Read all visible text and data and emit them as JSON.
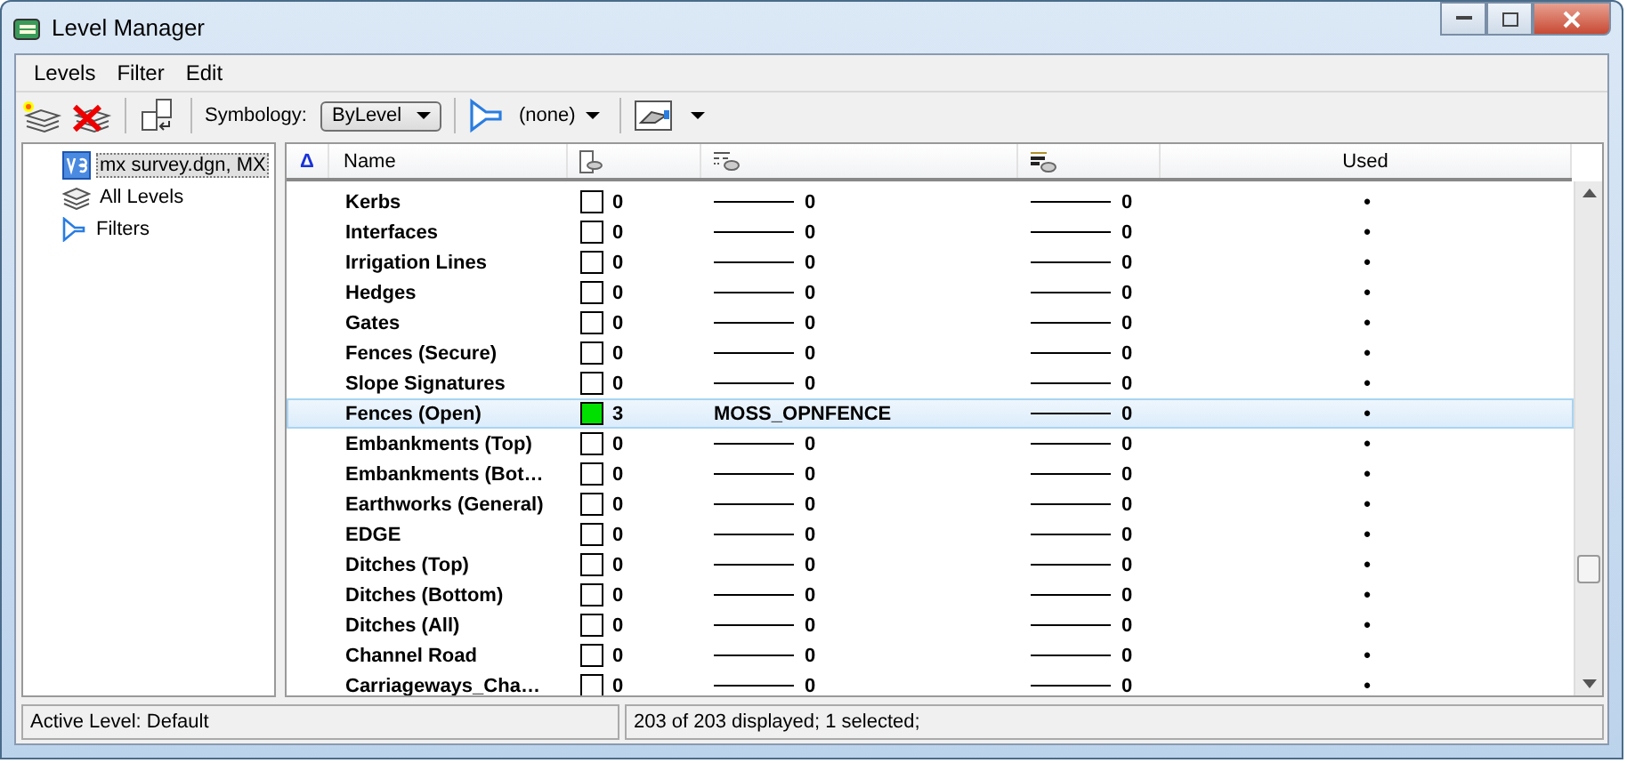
{
  "window": {
    "title": "Level Manager"
  },
  "menu": [
    "Levels",
    "Filter",
    "Edit"
  ],
  "toolbar": {
    "symbology_label": "Symbology:",
    "symbology_value": "ByLevel",
    "filter_value": "(none)"
  },
  "tree": [
    {
      "label": "mx survey.dgn, MX",
      "kind": "file",
      "selected": true
    },
    {
      "label": "All Levels",
      "kind": "levels",
      "selected": false
    },
    {
      "label": "Filters",
      "kind": "filter",
      "selected": false
    }
  ],
  "table": {
    "sort_mark": "Δ",
    "columns": [
      "Name",
      "Used"
    ],
    "rows": [
      {
        "name": "Kerbs",
        "color": "#ffffff",
        "color_num": "0",
        "style": {
          "kind": "line",
          "text": "0"
        },
        "weight": "0",
        "used": "•",
        "selected": false
      },
      {
        "name": "Interfaces",
        "color": "#ffffff",
        "color_num": "0",
        "style": {
          "kind": "line",
          "text": "0"
        },
        "weight": "0",
        "used": "•",
        "selected": false
      },
      {
        "name": "Irrigation Lines",
        "color": "#ffffff",
        "color_num": "0",
        "style": {
          "kind": "line",
          "text": "0"
        },
        "weight": "0",
        "used": "•",
        "selected": false
      },
      {
        "name": "Hedges",
        "color": "#ffffff",
        "color_num": "0",
        "style": {
          "kind": "line",
          "text": "0"
        },
        "weight": "0",
        "used": "•",
        "selected": false
      },
      {
        "name": "Gates",
        "color": "#ffffff",
        "color_num": "0",
        "style": {
          "kind": "line",
          "text": "0"
        },
        "weight": "0",
        "used": "•",
        "selected": false
      },
      {
        "name": "Fences (Secure)",
        "color": "#ffffff",
        "color_num": "0",
        "style": {
          "kind": "line",
          "text": "0"
        },
        "weight": "0",
        "used": "•",
        "selected": false
      },
      {
        "name": "Slope Signatures",
        "color": "#ffffff",
        "color_num": "0",
        "style": {
          "kind": "line",
          "text": "0"
        },
        "weight": "0",
        "used": "•",
        "selected": false
      },
      {
        "name": "Fences (Open)",
        "color": "#00e000",
        "color_num": "3",
        "style": {
          "kind": "name",
          "text": "MOSS_OPNFENCE"
        },
        "weight": "0",
        "used": "•",
        "selected": true
      },
      {
        "name": "Embankments (Top)",
        "color": "#ffffff",
        "color_num": "0",
        "style": {
          "kind": "line",
          "text": "0"
        },
        "weight": "0",
        "used": "•",
        "selected": false
      },
      {
        "name": "Embankments (Bot…",
        "color": "#ffffff",
        "color_num": "0",
        "style": {
          "kind": "line",
          "text": "0"
        },
        "weight": "0",
        "used": "•",
        "selected": false
      },
      {
        "name": "Earthworks (General)",
        "color": "#ffffff",
        "color_num": "0",
        "style": {
          "kind": "line",
          "text": "0"
        },
        "weight": "0",
        "used": "•",
        "selected": false
      },
      {
        "name": "EDGE",
        "color": "#ffffff",
        "color_num": "0",
        "style": {
          "kind": "line",
          "text": "0"
        },
        "weight": "0",
        "used": "•",
        "selected": false
      },
      {
        "name": "Ditches (Top)",
        "color": "#ffffff",
        "color_num": "0",
        "style": {
          "kind": "line",
          "text": "0"
        },
        "weight": "0",
        "used": "•",
        "selected": false
      },
      {
        "name": "Ditches (Bottom)",
        "color": "#ffffff",
        "color_num": "0",
        "style": {
          "kind": "line",
          "text": "0"
        },
        "weight": "0",
        "used": "•",
        "selected": false
      },
      {
        "name": "Ditches (All)",
        "color": "#ffffff",
        "color_num": "0",
        "style": {
          "kind": "line",
          "text": "0"
        },
        "weight": "0",
        "used": "•",
        "selected": false
      },
      {
        "name": "Channel Road",
        "color": "#ffffff",
        "color_num": "0",
        "style": {
          "kind": "line",
          "text": "0"
        },
        "weight": "0",
        "used": "•",
        "selected": false
      },
      {
        "name": "Carriageways_Cha…",
        "color": "#ffffff",
        "color_num": "0",
        "style": {
          "kind": "line",
          "text": "0"
        },
        "weight": "0",
        "used": "•",
        "selected": false
      }
    ]
  },
  "status_bar": [
    "Active Level: Default",
    "203 of 203 displayed; 1 selected;"
  ]
}
